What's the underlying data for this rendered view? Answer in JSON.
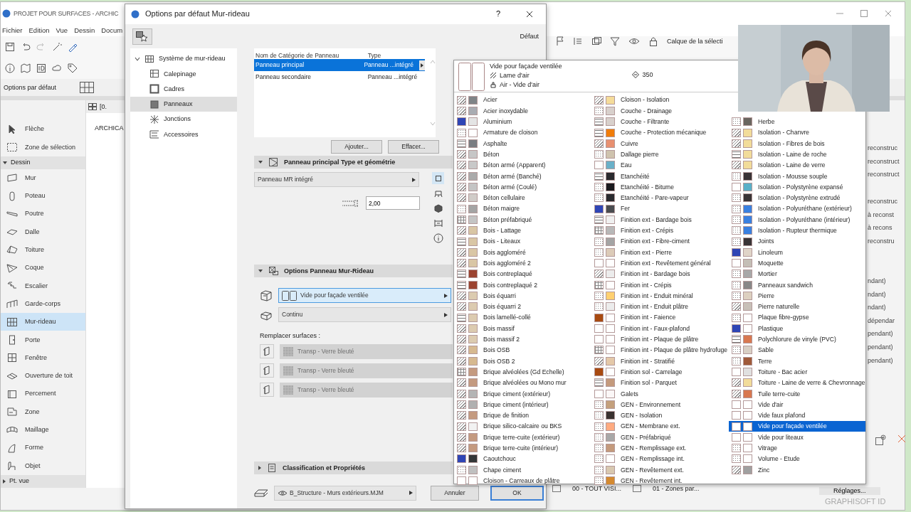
{
  "app": {
    "title": "PROJET POUR SURFACES - ARCHIC",
    "menu": [
      "Fichier",
      "Edition",
      "Vue",
      "Dessin",
      "Docum"
    ],
    "info_label": "Options par défaut",
    "toolbox": {
      "top_items": [
        {
          "label": "Flèche",
          "selected": false
        },
        {
          "label": "Zone de sélection",
          "selected": false
        }
      ],
      "sections": [
        {
          "label": "Dessin",
          "expanded": true,
          "items": [
            {
              "label": "Mur",
              "selected": false
            },
            {
              "label": "Poteau",
              "selected": false
            },
            {
              "label": "Poutre",
              "selected": false
            },
            {
              "label": "Dalle",
              "selected": false
            },
            {
              "label": "Toiture",
              "selected": false
            },
            {
              "label": "Coque",
              "selected": false
            },
            {
              "label": "Escalier",
              "selected": false
            },
            {
              "label": "Garde-corps",
              "selected": false
            },
            {
              "label": "Mur-rideau",
              "selected": true
            },
            {
              "label": "Porte",
              "selected": false
            },
            {
              "label": "Fenêtre",
              "selected": false
            },
            {
              "label": "Ouverture de toit",
              "selected": false
            },
            {
              "label": "Percement",
              "selected": false
            },
            {
              "label": "Zone",
              "selected": false
            },
            {
              "label": "Maillage",
              "selected": false
            },
            {
              "label": "Forme",
              "selected": false
            },
            {
              "label": "Objet",
              "selected": false
            }
          ]
        },
        {
          "label": "Pt. vue",
          "expanded": false
        }
      ]
    },
    "viewport": {
      "tab": "[0.",
      "text": "ARCHICA"
    },
    "layer_label": "Calque de la sélecti",
    "side_fragments_1": [
      "reconstruc",
      "reconstruct",
      "reconstruct"
    ],
    "side_fragments_2": [
      "reconstruc",
      "à reconst",
      "à recons",
      "reconstru"
    ],
    "side_fragments_3": [
      "ndant)",
      "ndant)",
      "ndant)",
      "dépendar",
      "pendant)",
      "pendant)",
      "pendant)"
    ],
    "bottom_bar": [
      "00 - TOUT VISI...",
      "01 - Zones par..."
    ],
    "settings_button": "Réglages...",
    "brand": "GRAPHISOFT ID"
  },
  "dialog": {
    "title": "Options par défaut Mur-rideau",
    "help": "?",
    "preset_label": "Défaut",
    "tree": [
      {
        "label": "Système de mur-rideau",
        "expanded": true,
        "selected": false,
        "children": [
          {
            "label": "Calepinage",
            "selected": false
          },
          {
            "label": "Cadres",
            "selected": false
          },
          {
            "label": "Panneaux",
            "selected": true
          },
          {
            "label": "Jonctions",
            "selected": false
          },
          {
            "label": "Accessoires",
            "selected": false
          }
        ]
      }
    ],
    "table": {
      "columns": [
        "Nom de Catégorie de Panneau",
        "Type"
      ],
      "rows": [
        {
          "cells": [
            "Panneau principal",
            "Panneau ...intégré"
          ],
          "selected": true
        },
        {
          "cells": [
            "Panneau secondaire",
            "Panneau ...intégré"
          ],
          "selected": false
        }
      ]
    },
    "table_buttons": [
      "Ajouter...",
      "Effacer..."
    ],
    "sections": [
      {
        "kind": "geometry",
        "title": "Panneau principal Type et géométrie",
        "expanded": true,
        "dropdown": "Panneau MR intégré",
        "field_value": "2,00",
        "tabs": [
          {
            "selected": true
          },
          {
            "selected": false
          },
          {
            "selected": false
          },
          {
            "selected": false
          },
          {
            "selected": false
          }
        ]
      },
      {
        "kind": "options",
        "title": "Options Panneau Mur-Rideau",
        "expanded": true,
        "surface_dropdown": {
          "value": "Vide pour façade ventilée",
          "active": true
        },
        "joint_dropdown": "Continu",
        "override_label": "Remplacer surfaces :",
        "overrides": [
          {
            "value": "Transp - Verre bleuté",
            "disabled": true
          },
          {
            "value": "Transp - Verre bleuté",
            "disabled": true
          },
          {
            "value": "Transp - Verre bleuté",
            "disabled": true
          }
        ]
      },
      {
        "kind": "classification",
        "title": "Classification et Propriétés",
        "expanded": false
      }
    ],
    "layer": "B_Structure - Murs extérieurs.MJM",
    "buttons": [
      {
        "label": "Annuler",
        "default": false
      },
      {
        "label": "OK",
        "default": true
      }
    ]
  },
  "popup": {
    "preview": {
      "name": "Vide pour façade ventilée",
      "fill": "Lame d'air",
      "material": "Air - Vide d'air",
      "priority": "350"
    },
    "columns": [
      [
        {
          "label": "Acier",
          "kind": "hatch",
          "color": "#7f8487",
          "selected": false
        },
        {
          "label": "Acier inoxydable",
          "kind": "hatch",
          "color": "#a9acb2",
          "selected": false
        },
        {
          "label": "Aluminium",
          "kind": "navy",
          "color": "#e4e4e4",
          "selected": false
        },
        {
          "label": "Armature de cloison",
          "kind": "dots",
          "color": "#ffffff",
          "selected": false
        },
        {
          "label": "Asphalte",
          "kind": "lines",
          "color": "#7a7d82",
          "selected": false
        },
        {
          "label": "Béton",
          "kind": "hatch",
          "color": "#c6c6c6",
          "selected": false
        },
        {
          "label": "Béton armé (Apparent)",
          "kind": "hatch",
          "color": "#c8c8c8",
          "selected": false
        },
        {
          "label": "Béton armé (Banché)",
          "kind": "hatch",
          "color": "#aaaaaa",
          "selected": false
        },
        {
          "label": "Béton armé (Coulé)",
          "kind": "hatch",
          "color": "#c4c4c4",
          "selected": false
        },
        {
          "label": "Béton cellulaire",
          "kind": "hatch",
          "color": "#d0ccc8",
          "selected": false
        },
        {
          "label": "Béton maigre",
          "kind": "dots",
          "color": "#a4a4a4",
          "selected": false
        },
        {
          "label": "Béton préfabriqué",
          "kind": "grid",
          "color": "#c4c4c4",
          "selected": false
        },
        {
          "label": "Bois - Lattage",
          "kind": "hatch",
          "color": "#d9c6a5",
          "selected": false
        },
        {
          "label": "Bois - Liteaux",
          "kind": "lines",
          "color": "#d9c6a5",
          "selected": false
        },
        {
          "label": "Bois aggloméré",
          "kind": "hatch",
          "color": "#d9c6a5",
          "selected": false
        },
        {
          "label": "Bois aggloméré 2",
          "kind": "hatch",
          "color": "#d9c6a5",
          "selected": false
        },
        {
          "label": "Bois contreplaqué",
          "kind": "lines",
          "color": "#9b4330",
          "selected": false
        },
        {
          "label": "Bois contreplaqué 2",
          "kind": "lines",
          "color": "#9b4330",
          "selected": false
        },
        {
          "label": "Bois équarri",
          "kind": "hatch",
          "color": "#dccbb0",
          "selected": false
        },
        {
          "label": "Bois équarri 2",
          "kind": "hatch",
          "color": "#dccbb0",
          "selected": false
        },
        {
          "label": "Bois lamellé-collé",
          "kind": "lines",
          "color": "#dccbb0",
          "selected": false
        },
        {
          "label": "Bois massif",
          "kind": "hatch",
          "color": "#dccbb0",
          "selected": false
        },
        {
          "label": "Bois massif 2",
          "kind": "hatch",
          "color": "#dccbb0",
          "selected": false
        },
        {
          "label": "Bois OSB",
          "kind": "hatch",
          "color": "#d6b990",
          "selected": false
        },
        {
          "label": "Bois OSB 2",
          "kind": "hatch",
          "color": "#d6b990",
          "selected": false
        },
        {
          "label": "Brique alvéolées (Gd Echelle)",
          "kind": "grid",
          "color": "#c49a80",
          "selected": false
        },
        {
          "label": "Brique alvéolées ou Mono mur",
          "kind": "hatch",
          "color": "#c49a80",
          "selected": false
        },
        {
          "label": "Brique ciment (extérieur)",
          "kind": "hatch",
          "color": "#b4b4b4",
          "selected": false
        },
        {
          "label": "Brique ciment (intérieur)",
          "kind": "hatch",
          "color": "#b0b0b0",
          "selected": false
        },
        {
          "label": "Brique de finition",
          "kind": "hatch",
          "color": "#c49a80",
          "selected": false
        },
        {
          "label": "Brique silico-calcaire ou BKS",
          "kind": "hatch",
          "color": "#f2f2f2",
          "selected": false
        },
        {
          "label": "Brique terre-cuite (extérieur)",
          "kind": "hatch",
          "color": "#c49a80",
          "selected": false
        },
        {
          "label": "Brique terre-cuite (intérieur)",
          "kind": "hatch",
          "color": "#c49a80",
          "selected": false
        },
        {
          "label": "Caoutchouc",
          "kind": "navy",
          "color": "#333638",
          "selected": false
        },
        {
          "label": "Chape ciment",
          "kind": "dots",
          "color": "#c0c0c0",
          "selected": false
        },
        {
          "label": "Cloison - Carreaux de plâtre",
          "kind": "plain",
          "color": "#ffffff",
          "selected": false
        }
      ],
      [
        {
          "label": "Cloison - Isolation",
          "kind": "hatch",
          "color": "#f5dc9a",
          "selected": false
        },
        {
          "label": "Couche - Drainage",
          "kind": "dots",
          "color": "#d8d0cc",
          "selected": false
        },
        {
          "label": "Couche - Filtrante",
          "kind": "lines",
          "color": "#d8d0cc",
          "selected": false
        },
        {
          "label": "Couche - Protection mécanique",
          "kind": "lines",
          "color": "#f07d0a",
          "selected": false
        },
        {
          "label": "Cuivre",
          "kind": "hatch",
          "color": "#e89070",
          "selected": false
        },
        {
          "label": "Dallage pierre",
          "kind": "dots",
          "color": "#cfc3ae",
          "selected": false
        },
        {
          "label": "Eau",
          "kind": "plain",
          "color": "#6ab0c8",
          "selected": false
        },
        {
          "label": "Etanchéité",
          "kind": "lines",
          "color": "#2a2a2e",
          "selected": false
        },
        {
          "label": "Etanchéité - Bitume",
          "kind": "dots",
          "color": "#1a1a1e",
          "selected": false
        },
        {
          "label": "Etanchéité - Pare-vapeur",
          "kind": "dots",
          "color": "#2a2a2e",
          "selected": false
        },
        {
          "label": "Fer",
          "kind": "navy",
          "color": "#4a4c50",
          "selected": false
        },
        {
          "label": "Finition ext - Bardage bois",
          "kind": "lines",
          "color": "#f0f0f0",
          "selected": false
        },
        {
          "label": "Finition ext - Crépis",
          "kind": "grid",
          "color": "#b8b8b8",
          "selected": false
        },
        {
          "label": "Finition ext - Fibre-ciment",
          "kind": "dots",
          "color": "#a4a4a4",
          "selected": false
        },
        {
          "label": "Finition ext - Pierre",
          "kind": "dots",
          "color": "#dccbb8",
          "selected": false
        },
        {
          "label": "Finition ext - Revêtement général",
          "kind": "plain",
          "color": "#ffffff",
          "selected": false
        },
        {
          "label": "Finition int - Bardage bois",
          "kind": "hatch",
          "color": "#ececec",
          "selected": false
        },
        {
          "label": "Finition int - Crépis",
          "kind": "grid",
          "color": "#ffffff",
          "selected": false
        },
        {
          "label": "Finition int - Enduit minéral",
          "kind": "dots",
          "color": "#ffd070",
          "selected": false
        },
        {
          "label": "Finition int - Enduit plâtre",
          "kind": "dots",
          "color": "#ececec",
          "selected": false
        },
        {
          "label": "Finition int - Faience",
          "kind": "rust",
          "color": "#ffffff",
          "selected": false
        },
        {
          "label": "Finition int - Faux-plafond",
          "kind": "plain",
          "color": "#ffffff",
          "selected": false
        },
        {
          "label": "Finition int - Plaque de plâtre",
          "kind": "plain",
          "color": "#ffffff",
          "selected": false
        },
        {
          "label": "Finition int - Plaque de plâtre hydrofuge",
          "kind": "grid",
          "color": "#ffffff",
          "selected": false
        },
        {
          "label": "Finition int - Stratifié",
          "kind": "hatch",
          "color": "#e4c8a8",
          "selected": false
        },
        {
          "label": "Finition sol - Carrelage",
          "kind": "rust",
          "color": "#ffffff",
          "selected": false
        },
        {
          "label": "Finition sol - Parquet",
          "kind": "lines",
          "color": "#c49a7c",
          "selected": false
        },
        {
          "label": "Galets",
          "kind": "plain",
          "color": "#fbf7f7",
          "selected": false
        },
        {
          "label": "GEN - Environnement",
          "kind": "dots",
          "color": "#c4a07c",
          "selected": false
        },
        {
          "label": "GEN - Isolation",
          "kind": "dots",
          "color": "#3a3230",
          "selected": false
        },
        {
          "label": "GEN - Membrane ext.",
          "kind": "dots",
          "color": "#ffab80",
          "selected": false
        },
        {
          "label": "GEN - Préfabriqué",
          "kind": "dots",
          "color": "#a8a8a8",
          "selected": false
        },
        {
          "label": "GEN - Remplissage ext.",
          "kind": "dots",
          "color": "#c49a7c",
          "selected": false
        },
        {
          "label": "GEN - Remplissage int.",
          "kind": "dots",
          "color": "#ffffff",
          "selected": false
        },
        {
          "label": "GEN - Revêtement ext.",
          "kind": "dots",
          "color": "#d8c8b0",
          "selected": false
        },
        {
          "label": "GEN - Revêtement int.",
          "kind": "dots",
          "color": "#d48a30",
          "selected": false
        }
      ],
      [
        {
          "label": "Herbe",
          "kind": "dots",
          "color": "#6a6660",
          "selected": false
        },
        {
          "label": "Isolation - Chanvre",
          "kind": "hatch",
          "color": "#f2dc9a",
          "selected": false
        },
        {
          "label": "Isolation - Fibres de bois",
          "kind": "hatch",
          "color": "#f2dc9a",
          "selected": false
        },
        {
          "label": "Isolation - Laine de roche",
          "kind": "lines",
          "color": "#f2dc9a",
          "selected": false
        },
        {
          "label": "Isolation - Laine de verre",
          "kind": "hatch",
          "color": "#f2dc9a",
          "selected": false
        },
        {
          "label": "Isolation - Mousse souple",
          "kind": "dots",
          "color": "#3a3436",
          "selected": false
        },
        {
          "label": "Isolation - Polystyrène expansé",
          "kind": "plain",
          "color": "#5ab0c8",
          "selected": false
        },
        {
          "label": "Isolation - Polystyrène extrudé",
          "kind": "dots",
          "color": "#3a3436",
          "selected": false
        },
        {
          "label": "Isolation - Polyuréthane (extérieur)",
          "kind": "dots",
          "color": "#3a80e0",
          "selected": false
        },
        {
          "label": "Isolation - Polyuréthane (intérieur)",
          "kind": "dots",
          "color": "#3a80e0",
          "selected": false
        },
        {
          "label": "Isolation - Rupteur thermique",
          "kind": "dots",
          "color": "#3a80e0",
          "selected": false
        },
        {
          "label": "Joints",
          "kind": "dots",
          "color": "#3a3436",
          "selected": false
        },
        {
          "label": "Linoleum",
          "kind": "navy",
          "color": "#e0d4c8",
          "selected": false
        },
        {
          "label": "Moquette",
          "kind": "plain",
          "color": "#c4beb6",
          "selected": false
        },
        {
          "label": "Mortier",
          "kind": "dots",
          "color": "#a8a8a8",
          "selected": false
        },
        {
          "label": "Panneaux sandwich",
          "kind": "dots",
          "color": "#888888",
          "selected": false
        },
        {
          "label": "Pierre",
          "kind": "dots",
          "color": "#ddd0c0",
          "selected": false
        },
        {
          "label": "Pierre naturelle",
          "kind": "hatch",
          "color": "#c8c0b8",
          "selected": false
        },
        {
          "label": "Plaque fibre-gypse",
          "kind": "dots",
          "color": "#ffffff",
          "selected": false
        },
        {
          "label": "Plastique",
          "kind": "navy",
          "color": "#ffffff",
          "selected": false
        },
        {
          "label": "Polychlorure de vinyle (PVC)",
          "kind": "lines",
          "color": "#d87850",
          "selected": false
        },
        {
          "label": "Sable",
          "kind": "dots",
          "color": "#d8cfc4",
          "selected": false
        },
        {
          "label": "Terre",
          "kind": "dots",
          "color": "#a05a3a",
          "selected": false
        },
        {
          "label": "Toiture - Bac acier",
          "kind": "plain",
          "color": "#e0e0e0",
          "selected": false
        },
        {
          "label": "Toiture - Laine de verre & Chevronnage",
          "kind": "hatch",
          "color": "#f2dc9a",
          "selected": false
        },
        {
          "label": "Tuile terre-cuite",
          "kind": "hatch",
          "color": "#d87850",
          "selected": false
        },
        {
          "label": "Vide d'air",
          "kind": "plain",
          "color": "#ffffff",
          "selected": false
        },
        {
          "label": "Vide faux plafond",
          "kind": "plain",
          "color": "#ffffff",
          "selected": false
        },
        {
          "label": "Vide pour façade ventilée",
          "kind": "plain",
          "color": "#ffffff",
          "selected": true
        },
        {
          "label": "Vide pour liteaux",
          "kind": "plain",
          "color": "#ffffff",
          "selected": false
        },
        {
          "label": "Vitrage",
          "kind": "dots",
          "color": "#ffffff",
          "selected": false
        },
        {
          "label": "Volume - Etude",
          "kind": "dots",
          "color": "#ffffff",
          "selected": false
        },
        {
          "label": "Zinc",
          "kind": "hatch",
          "color": "#a0a0a0",
          "selected": false
        }
      ]
    ]
  }
}
